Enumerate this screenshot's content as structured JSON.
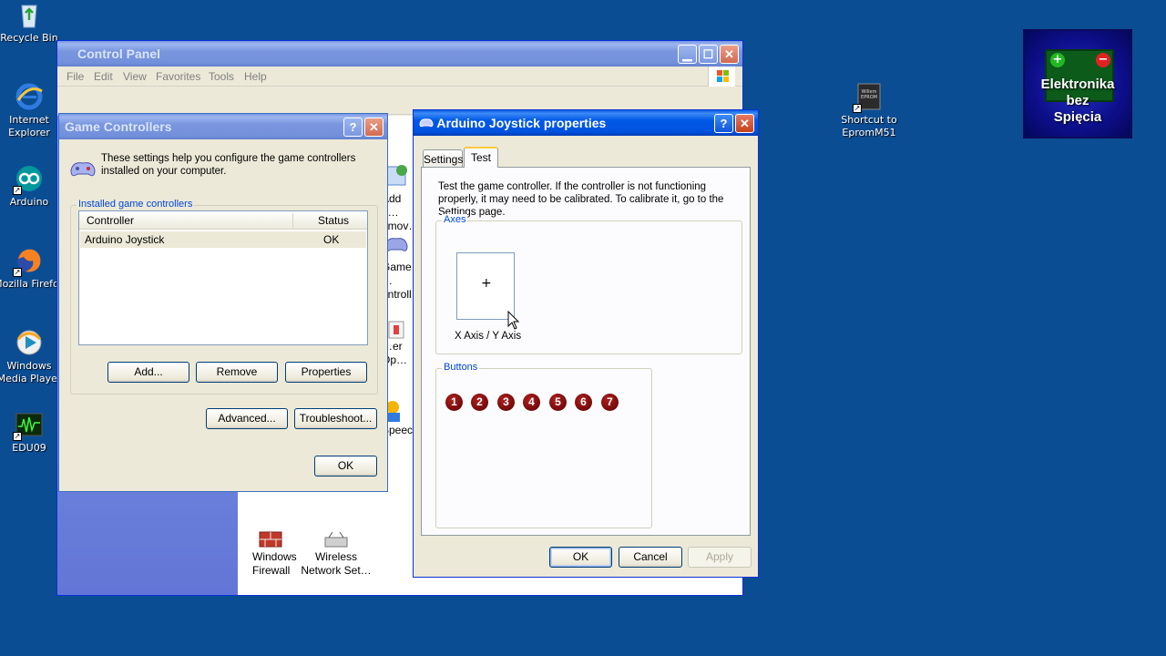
{
  "desktop": {
    "icons": [
      {
        "label": "Recycle Bin"
      },
      {
        "label": "Internet Explorer"
      },
      {
        "label": "Arduino"
      },
      {
        "label": "Mozilla Firefox"
      },
      {
        "label": "Windows Media Player"
      },
      {
        "label": "EDU09"
      },
      {
        "label": "Shortcut to EpromM51",
        "image_text": "Willem EPROM"
      }
    ],
    "logo": {
      "line1": "Elektronika",
      "line2": "bez",
      "line3": "Spięcia"
    }
  },
  "control_panel": {
    "title": "Control Panel",
    "menu": [
      "File",
      "Edit",
      "View",
      "Favorites",
      "Tools",
      "Help"
    ],
    "items": [
      {
        "label": "Add o… emov…"
      },
      {
        "label": "Game …ontroll…"
      },
      {
        "label": "…er Op…"
      },
      {
        "label": "Speec…"
      },
      {
        "label": "Windows Firewall"
      },
      {
        "label": "Wireless Network Set…"
      }
    ]
  },
  "game_controllers": {
    "title": "Game Controllers",
    "description": "These settings help you configure the game controllers installed on your computer.",
    "group_label": "Installed game controllers",
    "columns": [
      "Controller",
      "Status"
    ],
    "rows": [
      {
        "controller": "Arduino Joystick",
        "status": "OK"
      }
    ],
    "buttons": {
      "add": "Add...",
      "remove": "Remove",
      "properties": "Properties",
      "advanced": "Advanced...",
      "troubleshoot": "Troubleshoot...",
      "ok": "OK"
    }
  },
  "joystick_props": {
    "title": "Arduino Joystick properties",
    "tabs": [
      "Settings",
      "Test"
    ],
    "active_tab": "Test",
    "description": "Test the game controller.  If the controller is not functioning properly, it may need to be calibrated.  To calibrate it, go to the Settings page.",
    "axes_label": "Axes",
    "axis_caption": "X Axis / Y Axis",
    "buttons_label": "Buttons",
    "button_numbers": [
      "1",
      "2",
      "3",
      "4",
      "5",
      "6",
      "7"
    ],
    "footer": {
      "ok": "OK",
      "cancel": "Cancel",
      "apply": "Apply"
    }
  },
  "title_buttons": {
    "help": "?",
    "close": "✕",
    "minimize": "▁",
    "maximize": "☐"
  }
}
